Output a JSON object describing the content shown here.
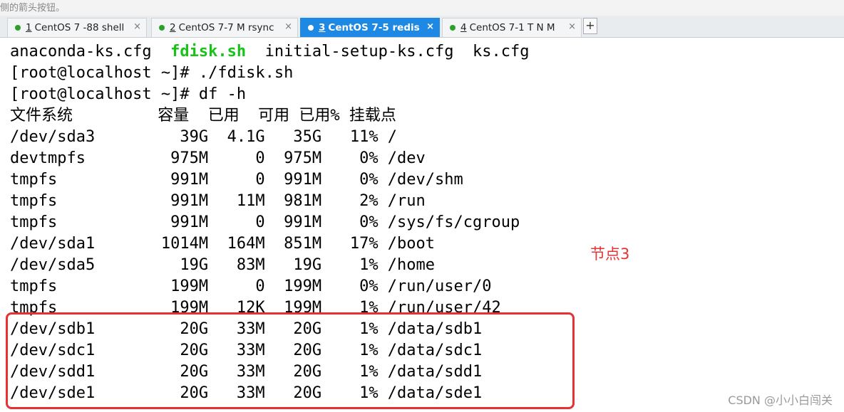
{
  "top_hint": "侧的箭头按钮。",
  "tabs": [
    {
      "num": "1",
      "label": "CentOS 7 -88 shell",
      "active": false
    },
    {
      "num": "2",
      "label": "CentOS 7-7 M rsync",
      "active": false
    },
    {
      "num": "3",
      "label": "CentOS 7-5   redis",
      "active": true
    },
    {
      "num": "4",
      "label": "CentOS 7-1 T N M",
      "active": false
    }
  ],
  "tab_close_glyph": "×",
  "tab_add_glyph": "+",
  "terminal": {
    "files_line": {
      "a": "anaconda-ks.cfg  ",
      "highlight": "fdisk.sh",
      "b": "  initial-setup-ks.cfg  ks.cfg"
    },
    "cmd1": "[root@localhost ~]# ./fdisk.sh",
    "cmd2": "[root@localhost ~]# df -h",
    "header": "文件系统         容量  已用  可用 已用% 挂载点",
    "rows": [
      "/dev/sda3         39G  4.1G   35G   11% /",
      "devtmpfs         975M     0  975M    0% /dev",
      "tmpfs            991M     0  991M    0% /dev/shm",
      "tmpfs            991M   11M  981M    2% /run",
      "tmpfs            991M     0  991M    0% /sys/fs/cgroup",
      "/dev/sda1       1014M  164M  851M   17% /boot",
      "/dev/sda5         19G   83M   19G    1% /home",
      "tmpfs            199M     0  199M    0% /run/user/0",
      "tmpfs            199M   12K  199M    1% /run/user/42",
      "/dev/sdb1         20G   33M   20G    1% /data/sdb1",
      "/dev/sdc1         20G   33M   20G    1% /data/sdc1",
      "/dev/sdd1         20G   33M   20G    1% /data/sdd1",
      "/dev/sde1         20G   33M   20G    1% /data/sde1"
    ]
  },
  "annotation": "节点3",
  "watermark": "CSDN @小小白闯关",
  "colors": {
    "active_tab": "#1e88e5",
    "highlight_green": "#19c219",
    "annotation_red": "#e53333"
  }
}
